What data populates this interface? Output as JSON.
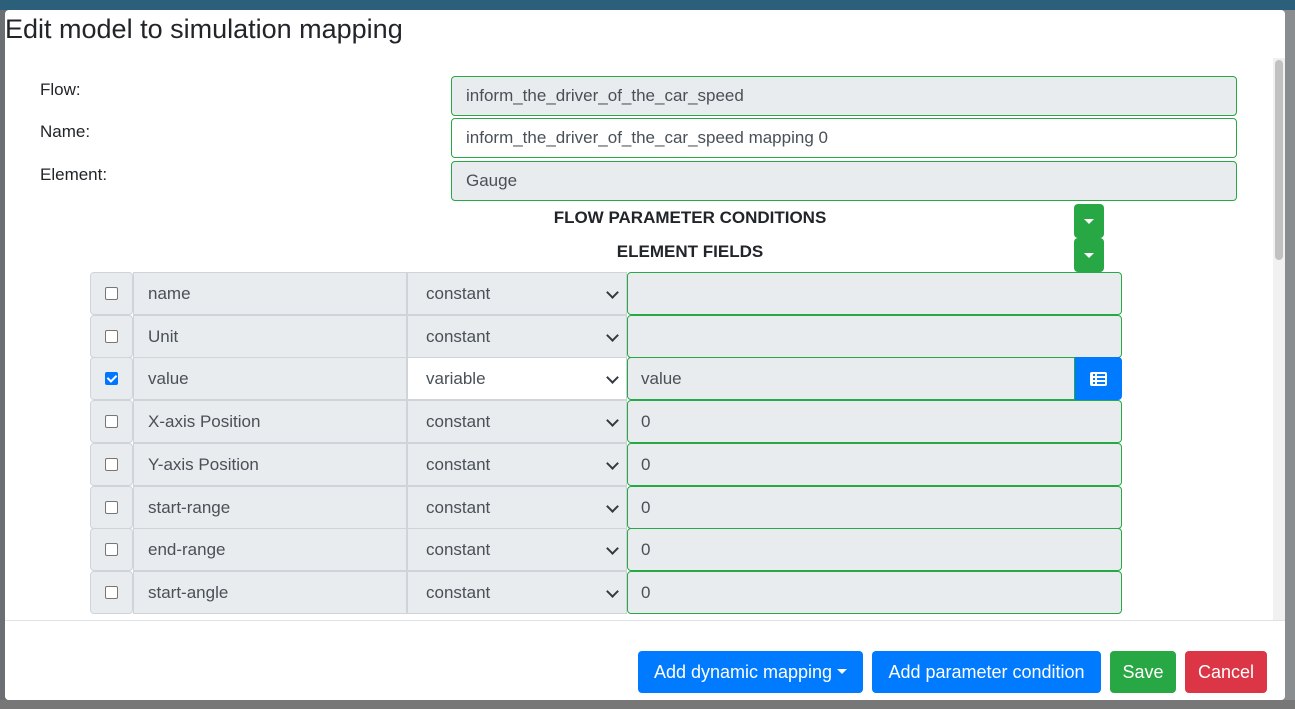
{
  "modal": {
    "title": "Edit model to simulation mapping"
  },
  "form": {
    "flow_label": "Flow:",
    "flow_value": "inform_the_driver_of_the_car_speed",
    "name_label": "Name:",
    "name_value": "inform_the_driver_of_the_car_speed mapping 0",
    "element_label": "Element:",
    "element_value": "Gauge"
  },
  "sections": {
    "flow_parameter_conditions": "FLOW PARAMETER CONDITIONS",
    "element_fields": "ELEMENT FIELDS"
  },
  "fields": [
    {
      "name": "name",
      "type": "constant",
      "value": "",
      "checked": false
    },
    {
      "name": "Unit",
      "type": "constant",
      "value": "",
      "checked": false
    },
    {
      "name": "value",
      "type": "variable",
      "value": "value",
      "checked": true
    },
    {
      "name": "X-axis Position",
      "type": "constant",
      "value": "0",
      "checked": false
    },
    {
      "name": "Y-axis Position",
      "type": "constant",
      "value": "0",
      "checked": false
    },
    {
      "name": "start-range",
      "type": "constant",
      "value": "0",
      "checked": false
    },
    {
      "name": "end-range",
      "type": "constant",
      "value": "0",
      "checked": false
    },
    {
      "name": "start-angle",
      "type": "constant",
      "value": "0",
      "checked": false
    }
  ],
  "footer": {
    "add_dynamic_mapping": "Add dynamic mapping",
    "add_parameter_condition": "Add parameter condition",
    "save": "Save",
    "cancel": "Cancel"
  },
  "colors": {
    "primary": "#007bff",
    "success": "#28a745",
    "danger": "#dc3545"
  }
}
